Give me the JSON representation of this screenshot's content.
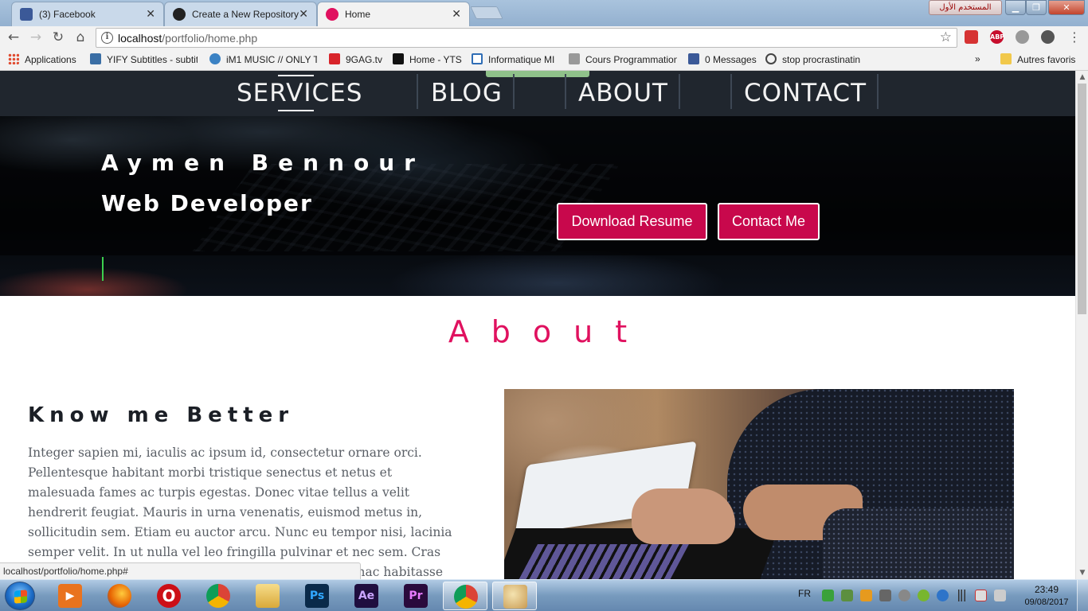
{
  "browser": {
    "tabs": [
      {
        "label": "(3) Facebook",
        "icon": "facebook-icon"
      },
      {
        "label": "Create a New Repository",
        "icon": "github-icon"
      },
      {
        "label": "Home",
        "icon": "site-icon",
        "active": true
      }
    ],
    "user_badge": "المستخدم الأول",
    "url_host": "localhost",
    "url_path": "/portfolio/home.php",
    "extensions": [
      {
        "name": "pdf-extension-icon",
        "color": "#d63333",
        "text": ""
      },
      {
        "name": "adblock-plus-icon",
        "color": "#c70d2c",
        "text": "ABP"
      },
      {
        "name": "extension-cloud-icon",
        "color": "#999999",
        "text": ""
      },
      {
        "name": "extension-disabled-icon",
        "color": "#555555",
        "text": ""
      }
    ]
  },
  "bookmarks": {
    "items": [
      {
        "label": "Applications",
        "icon": "apps-grid-icon",
        "color": "#e04a2f"
      },
      {
        "label": "YIFY Subtitles - subtit",
        "icon": "yify-icon",
        "color": "#3a6ea5"
      },
      {
        "label": "iM1 MUSIC // ONLY T",
        "icon": "im1-music-icon",
        "color": "#3b82c4"
      },
      {
        "label": "9GAG.tv",
        "icon": "9gag-icon",
        "color": "#d8242a"
      },
      {
        "label": "Home - YTS",
        "icon": "yts-icon",
        "color": "#111111"
      },
      {
        "label": "Informatique MI",
        "icon": "page-icon",
        "color": "#2f6db5"
      },
      {
        "label": "Cours Programmation",
        "icon": "cours-icon",
        "color": "#777777"
      },
      {
        "label": "0 Messages",
        "icon": "facebook-icon",
        "color": "#3b5998"
      },
      {
        "label": "stop procrastinatin",
        "icon": "link-icon",
        "color": "#444444"
      }
    ],
    "overflow": "»",
    "other": {
      "label": "Autres favoris",
      "icon": "folder-icon",
      "color": "#f1c84b"
    }
  },
  "site": {
    "nav": [
      "SERVICES",
      "BLOG",
      "ABOUT",
      "CONTACT"
    ],
    "hero": {
      "name": "Aymen Bennour",
      "role": "Web Developer",
      "buttons": [
        "Download Resume",
        "Contact Me"
      ]
    },
    "about": {
      "title": "About",
      "heading": "Know me Better",
      "body": "Integer sapien mi, iaculis ac ipsum id, consectetur ornare orci. Pellentesque habitant morbi tristique senectus et netus et malesuada fames ac turpis egestas. Donec vitae tellus a velit hendrerit feugiat. Mauris in urna venenatis, euismod metus in, sollicitudin sem. Etiam eu auctor arcu. Nunc eu tempor nisi, lacinia semper velit. In ut nulla vel leo fringilla pulvinar et nec sem. Cras vel urna at turpis sollicitudin rhoncus id a ipsum. In hac habitasse platea dictumst. Vivamus in tincidunt nibh, eu dictum tortor sodales"
    },
    "accent": "#e0115f",
    "button_color": "#c8084c"
  },
  "status_bar": "localhost/portfolio/home.php#",
  "taskbar": {
    "apps": [
      {
        "name": "media-player-icon",
        "color": "#e9731e",
        "text": "▶"
      },
      {
        "name": "firefox-icon",
        "color": "#e66000",
        "text": ""
      },
      {
        "name": "opera-icon",
        "color": "#cc0f16",
        "text": "O"
      },
      {
        "name": "chrome-icon",
        "color": "#4285f4",
        "text": ""
      },
      {
        "name": "file-explorer-icon",
        "color": "#e8c15a",
        "text": ""
      },
      {
        "name": "photoshop-icon",
        "color": "#0a2a4a",
        "text": "Ps"
      },
      {
        "name": "after-effects-icon",
        "color": "#1f0e3f",
        "text": "Ae"
      },
      {
        "name": "premiere-icon",
        "color": "#2a0a3c",
        "text": "Pr"
      },
      {
        "name": "chrome-icon",
        "color": "#4285f4",
        "text": "",
        "active": true
      },
      {
        "name": "paint-icon",
        "color": "#6c9bc8",
        "text": "",
        "active": true
      }
    ],
    "language": "FR",
    "time": "23:49",
    "date": "09/08/2017"
  }
}
